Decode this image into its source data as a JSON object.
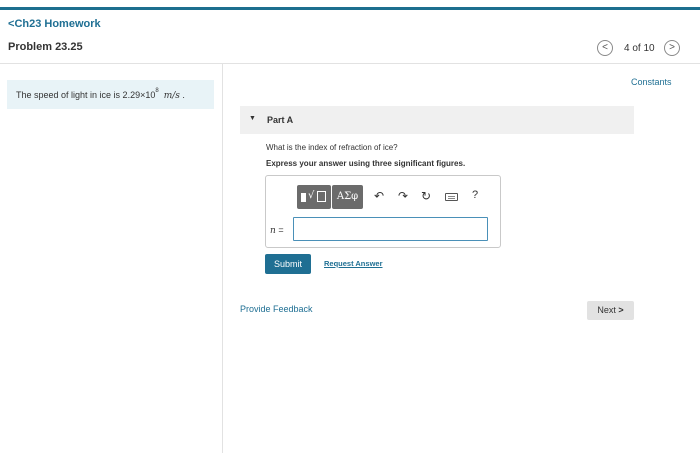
{
  "header": {
    "back_label": "Ch23 Homework",
    "problem_title": "Problem 23.25",
    "nav_prev": "<",
    "nav_count": "4 of 10",
    "nav_next": ">"
  },
  "statement": {
    "text_prefix": "The speed of light in ice is 2.29×10",
    "exponent": "8",
    "unit": "m/s",
    "suffix": "."
  },
  "constants_label": "Constants",
  "part": {
    "title": "Part A",
    "question": "What is the index of refraction of ice?",
    "instruction": "Express your answer using three significant figures."
  },
  "toolbar": {
    "greek_label": "ΑΣφ",
    "undo_glyph": "↶",
    "redo_glyph": "↷",
    "reset_glyph": "↻",
    "help_label": "?",
    "icons": [
      "template-icon",
      "greek-letters-icon",
      "undo-icon",
      "redo-icon",
      "reset-icon",
      "keyboard-icon",
      "help-icon"
    ]
  },
  "answer": {
    "variable": "n",
    "equals": "=",
    "value": "",
    "placeholder": ""
  },
  "buttons": {
    "submit": "Submit",
    "request_answer": "Request Answer",
    "next": "Next"
  },
  "footer": {
    "feedback": "Provide Feedback"
  },
  "colors": {
    "accent": "#1f6f93",
    "topbar": "#1c6f8f",
    "statement_bg": "#e8f3f7",
    "part_bar_bg": "#f0f0f0",
    "tool_grey": "#6b6b6b"
  }
}
